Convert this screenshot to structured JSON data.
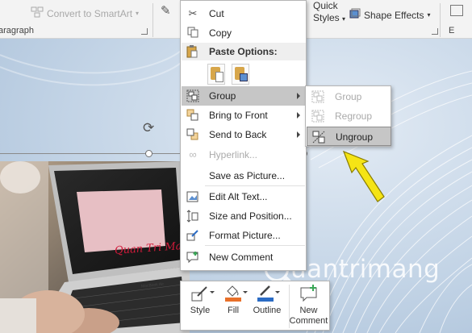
{
  "ribbon": {
    "convert_smartart": "Convert to SmartArt",
    "paragraph_group": "aragraph",
    "quick_styles_line1": "Quick",
    "quick_styles_line2": "Styles",
    "shape_effects": "Shape Effects",
    "editing_group": "E"
  },
  "context_menu": {
    "cut": "Cut",
    "copy": "Copy",
    "paste_options_header": "Paste Options:",
    "group": "Group",
    "bring_to_front": "Bring to Front",
    "send_to_back": "Send to Back",
    "hyperlink": "Hyperlink...",
    "save_as_picture": "Save as Picture...",
    "edit_alt_text": "Edit Alt Text...",
    "size_and_position": "Size and Position...",
    "format_picture": "Format Picture...",
    "new_comment": "New Comment"
  },
  "group_submenu": {
    "group": "Group",
    "regroup": "Regroup",
    "ungroup": "Ungroup"
  },
  "mini_toolbar": {
    "style": "Style",
    "fill": "Fill",
    "outline": "Outline",
    "new_comment_line1": "New",
    "new_comment_line2": "Comment"
  },
  "photo_text": "Quan Tri Ma",
  "laptop_label": "MacBook Air",
  "watermark": "uantrimang",
  "colors": {
    "highlight": "#c6c6c6",
    "arrow_fill": "#f5e415",
    "fill_accent": "#e8702a",
    "outline_accent": "#2b6cc4",
    "comment_accent": "#3aa757"
  }
}
